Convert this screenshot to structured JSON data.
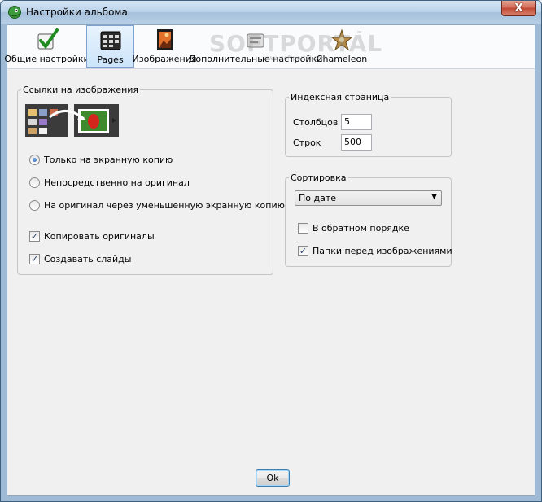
{
  "window": {
    "title": "Настройки альбома",
    "close_glyph": "X"
  },
  "toolbar": {
    "items": [
      {
        "label": "Общие настройки",
        "icon": "checkmark-icon"
      },
      {
        "label": "Pages",
        "icon": "pages-icon",
        "active": true
      },
      {
        "label": "Изображения",
        "icon": "image-icon"
      },
      {
        "label": "Дополнительные настройки",
        "icon": "settings-icon"
      },
      {
        "label": "Chameleon",
        "icon": "chameleon-icon"
      }
    ]
  },
  "watermark": {
    "text": "SOFTPORTAL",
    "tm": "™",
    "url": "www.softportal.com"
  },
  "links_group": {
    "legend": "Ссылки на изображения",
    "radios": [
      {
        "label": "Только на экранную копию",
        "checked": true
      },
      {
        "label": "Непосредственно на оригинал",
        "checked": false
      },
      {
        "label": "На оригинал через уменьшенную экранную копию",
        "checked": false
      }
    ],
    "checkboxes": [
      {
        "label": "Копировать оригиналы",
        "checked": true
      },
      {
        "label": "Создавать слайды",
        "checked": true
      }
    ]
  },
  "index_group": {
    "legend": "Индексная страница",
    "columns_label": "Столбцов",
    "columns_value": "5",
    "rows_label": "Строк",
    "rows_value": "500"
  },
  "sort_group": {
    "legend": "Сортировка",
    "selected": "По дате",
    "reverse_label": "В обратном порядке",
    "reverse_checked": false,
    "folders_first_label": "Папки перед изображениями",
    "folders_first_checked": true
  },
  "footer": {
    "ok_label": "Ok"
  },
  "colors": {
    "accent": "#7da2ce",
    "close": "#c04a33"
  }
}
